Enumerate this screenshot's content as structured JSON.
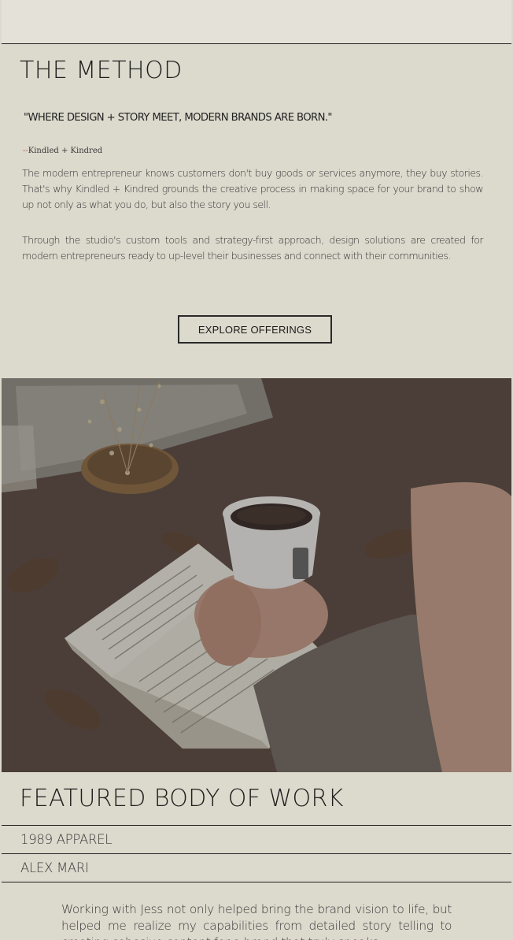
{
  "method": {
    "title": "THE METHOD",
    "quote": "\"WHERE DESIGN + STORY MEET, MODERN BRANDS ARE BORN.\"",
    "attribution_dash": "--",
    "attribution_name": "Kindled + Kindred",
    "paragraph_1": "The modern entrepreneur knows customers don't buy goods or services anymore, they buy stories. That's why Kindled + Kindred grounds the creative process in making space for your brand to show up not only as what you do, but also the story you sell.",
    "paragraph_2": "Through the studio's custom tools and strategy-first approach, design solutions are created for modern entrepreneurs ready to up-level their businesses and connect with their communities.",
    "cta_label": "EXPLORE OFFERINGS"
  },
  "featured": {
    "title": "FEATURED BODY OF WORK",
    "items": [
      {
        "label": "1989 APPAREL"
      },
      {
        "label": "ALEX MARI"
      }
    ],
    "testimonial": "Working with Jess not only helped bring the brand vision to life, but helped me realize my capabilities from detailed story telling to creating cohesive content for a brand that truly speaks."
  },
  "colors": {
    "background": "#dcd9cd",
    "top_band": "#e4e2d8",
    "text": "#2e2e2e",
    "rule": "#222222",
    "attribution_dash": "#a85a4a"
  },
  "icons": {
    "hero_photo": "coffee-cup-and-open-book-photo"
  }
}
